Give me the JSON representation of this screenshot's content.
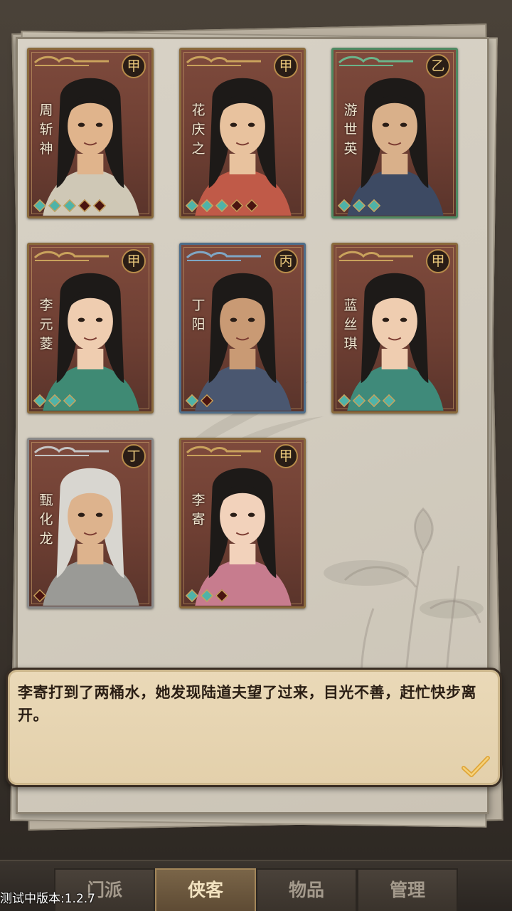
{
  "heroes": [
    {
      "name": "周斩神",
      "grade": "甲",
      "gems": [
        true,
        true,
        true,
        false,
        false
      ]
    },
    {
      "name": "花庆之",
      "grade": "甲",
      "gems": [
        true,
        true,
        true,
        false,
        false
      ]
    },
    {
      "name": "游世英",
      "grade": "乙",
      "gems": [
        true,
        true,
        true
      ]
    },
    {
      "name": "李元菱",
      "grade": "甲",
      "gems": [
        true,
        true,
        true
      ]
    },
    {
      "name": "丁阳",
      "grade": "丙",
      "gems": [
        true,
        false
      ]
    },
    {
      "name": "蓝丝琪",
      "grade": "甲",
      "gems": [
        true,
        true,
        true,
        true
      ]
    },
    {
      "name": "甄化龙",
      "grade": "丁",
      "gems": [
        false
      ]
    },
    {
      "name": "李寄",
      "grade": "甲",
      "gems": [
        true,
        true,
        false
      ]
    }
  ],
  "dialog": {
    "text": "李寄打到了两桶水，她发现陆道夫望了过来，目光不善，赶忙快步离开。"
  },
  "nav": {
    "tabs": [
      {
        "label": "门派",
        "active": false
      },
      {
        "label": "侠客",
        "active": true
      },
      {
        "label": "物品",
        "active": false
      },
      {
        "label": "管理",
        "active": false
      }
    ]
  },
  "version_label": "测试中版本:1.2.7",
  "colors": {
    "gem_active": "#4fb3a8",
    "gem_inactive": "#4a1410",
    "card_bg": "#6e3f33",
    "active_tab": "#7a6548"
  }
}
